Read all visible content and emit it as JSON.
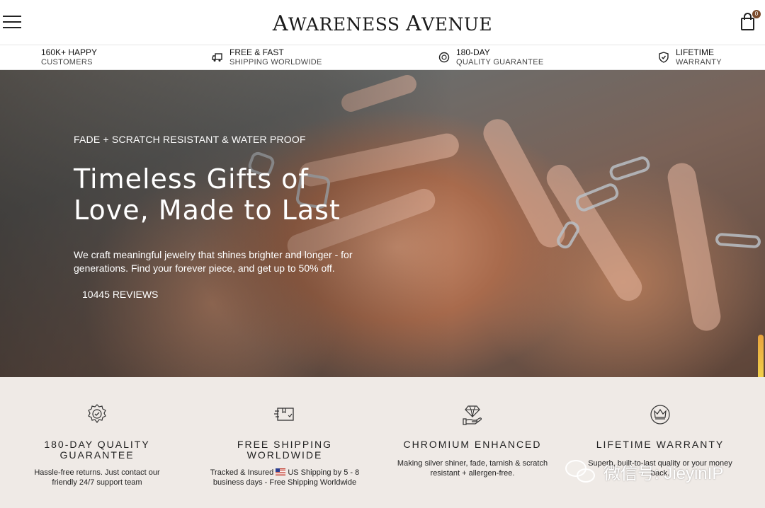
{
  "header": {
    "menu_icon": "hamburger-menu-icon",
    "logo_first_initial": "A",
    "logo_first_rest": "WARENESS",
    "logo_second_initial": "A",
    "logo_second_rest": "VENUE",
    "cart_icon": "shopping-bag-icon",
    "cart_count": "0"
  },
  "trust_bar": [
    {
      "icon": "none",
      "line1": "160K+ HAPPY",
      "line2": "CUSTOMERS"
    },
    {
      "icon": "truck-icon",
      "line1": "FREE & FAST",
      "line2": "SHIPPING WORLDWIDE"
    },
    {
      "icon": "refresh-badge-icon",
      "line1": "180-DAY",
      "line2": "QUALITY GUARANTEE"
    },
    {
      "icon": "shield-check-icon",
      "line1": "LIFETIME",
      "line2": "WARRANTY"
    }
  ],
  "hero": {
    "eyebrow": "FADE + SCRATCH RESISTANT & WATER PROOF",
    "title_line1": "Timeless Gifts of",
    "title_line2": "Love, Made to Last",
    "description": "We craft meaningful jewelry that shines brighter and longer - for generations. Find your forever piece, and get up to 50% off.",
    "reviews": "10445 REVIEWS"
  },
  "features": [
    {
      "icon": "badge-check-icon",
      "title_line1": "180-DAY QUALITY",
      "title_line2": "GUARANTEE",
      "desc_line1": "Hassle-free returns. Just contact our",
      "desc_line2": "friendly 24/7 support team"
    },
    {
      "icon": "shipping-box-icon",
      "title_line1": "FREE SHIPPING",
      "title_line2": "WORLDWIDE",
      "desc_pre": "Tracked & Insured",
      "desc_post": "US Shipping by 5 - 8",
      "desc_line2": "business days - Free Shipping Worldwide"
    },
    {
      "icon": "diamond-hand-icon",
      "title_line1": "CHROMIUM ENHANCED",
      "title_line2": "",
      "desc_line1": "Making silver shiner, fade, tarnish & scratch",
      "desc_line2": "resistant + allergen-free."
    },
    {
      "icon": "crown-badge-icon",
      "title_line1": "LIFETIME WARRANTY",
      "title_line2": "",
      "desc_line1": "Superb, built-to-last quality or your money",
      "desc_line2": "back."
    }
  ],
  "watermark": {
    "text": "微信号: JieyinIP"
  },
  "colors": {
    "accent": "#7a4b2c",
    "features_bg": "#efeae6"
  }
}
